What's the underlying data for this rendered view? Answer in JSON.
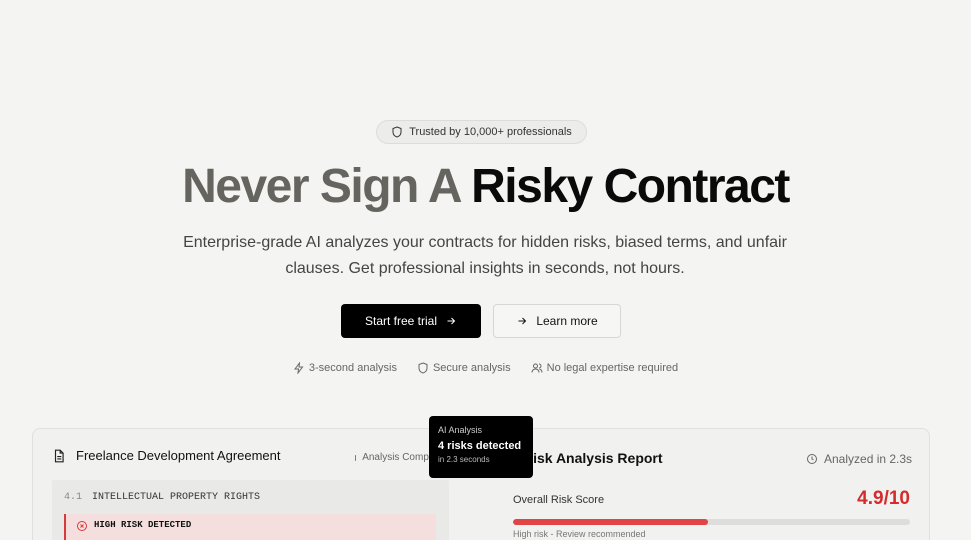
{
  "hero": {
    "badge": "Trusted by 10,000+ professionals",
    "title_muted": "Never Sign A",
    "title_strong": "Risky Contract",
    "subtitle": "Enterprise-grade AI analyzes your contracts for hidden risks, biased terms, and unfair clauses. Get professional insights in seconds, not hours.",
    "primary_button": "Start free trial",
    "secondary_button": "Learn more",
    "features": [
      "3-second analysis",
      "Secure analysis",
      "No legal expertise required"
    ]
  },
  "document": {
    "title": "Freelance Development Agreement",
    "status": "Analysis Complete",
    "clause_number": "4.1",
    "clause_title": "INTELLECTUAL PROPERTY RIGHTS",
    "risk_flag": "HIGH RISK DETECTED"
  },
  "tooltip": {
    "label": "AI Analysis",
    "main": "4 risks detected",
    "sub": "in 2.3 seconds"
  },
  "report": {
    "title": "Risk Analysis Report",
    "analyzed": "Analyzed in 2.3s",
    "score_label": "Overall Risk Score",
    "score_value": "4.9/10",
    "score_fraction": 0.49,
    "score_note": "High risk - Review recommended"
  },
  "colors": {
    "accent_red": "#d42c2c",
    "status_green": "#22b14c"
  }
}
